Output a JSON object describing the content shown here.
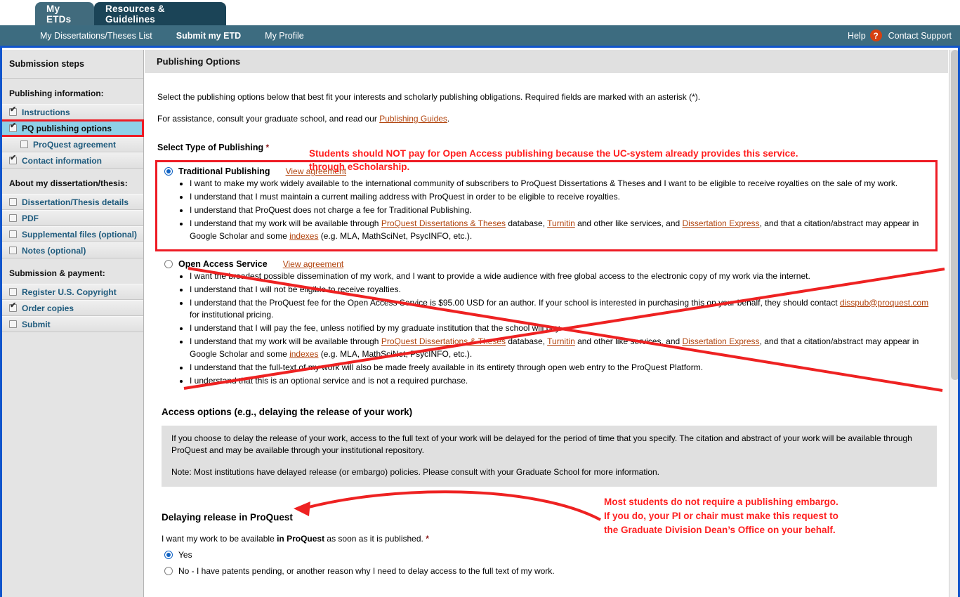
{
  "tabs": [
    {
      "label": "My ETDs",
      "active": true
    },
    {
      "label": "Resources & Guidelines",
      "active": false
    }
  ],
  "nav": {
    "links": [
      {
        "label": "My Dissertations/Theses List",
        "active": false
      },
      {
        "label": "Submit my ETD",
        "active": true
      },
      {
        "label": "My Profile",
        "active": false
      }
    ],
    "help_label": "Help",
    "help_icon": "question-mark-icon",
    "contact_label": "Contact Support"
  },
  "sidebar": {
    "title": "Submission steps",
    "groups": [
      {
        "heading": "Publishing information:",
        "items": [
          {
            "label": "Instructions",
            "checked": true,
            "sub": false,
            "selected": false
          },
          {
            "label": "PQ publishing options",
            "checked": true,
            "sub": false,
            "selected": true
          },
          {
            "label": "ProQuest agreement",
            "checked": false,
            "sub": true,
            "selected": false
          },
          {
            "label": "Contact information",
            "checked": true,
            "sub": false,
            "selected": false
          }
        ]
      },
      {
        "heading": "About my dissertation/thesis:",
        "items": [
          {
            "label": "Dissertation/Thesis details",
            "checked": false,
            "sub": false,
            "selected": false
          },
          {
            "label": "PDF",
            "checked": false,
            "sub": false,
            "selected": false
          },
          {
            "label": "Supplemental files (optional)",
            "checked": false,
            "sub": false,
            "selected": false
          },
          {
            "label": "Notes (optional)",
            "checked": false,
            "sub": false,
            "selected": false
          }
        ]
      },
      {
        "heading": "Submission & payment:",
        "items": [
          {
            "label": "Register U.S. Copyright",
            "checked": false,
            "sub": false,
            "selected": false
          },
          {
            "label": "Order copies",
            "checked": true,
            "sub": false,
            "selected": false
          },
          {
            "label": "Submit",
            "checked": false,
            "sub": false,
            "selected": false
          }
        ]
      }
    ]
  },
  "main": {
    "header": "Publishing Options",
    "intro1": "Select the publishing options below that best fit your interests and scholarly publishing obligations. Required fields are marked with an asterisk (*).",
    "intro2_pre": "For assistance, consult your graduate school, and read our ",
    "intro2_link": "Publishing Guides",
    "intro2_post": ".",
    "select_type_label": "Select Type of Publishing",
    "required_mark": "*",
    "view_agreement": "View agreement",
    "traditional": {
      "title": "Traditional Publishing",
      "selected": true,
      "bullets": [
        "I want to make my work widely available to the international community of subscribers to ProQuest Dissertations & Theses and I want to be eligible to receive royalties on the sale of my work.",
        "I understand that I must maintain a current mailing address with ProQuest in order to be eligible to receive royalties.",
        "I understand that ProQuest does not charge a fee for Traditional Publishing."
      ],
      "last_bullet": {
        "p1": "I understand that my work will be available through ",
        "l1": "ProQuest Dissertations & Theses",
        "p2": " database, ",
        "l2": "Turnitin",
        "p3": " and other like services, and ",
        "l3": "Dissertation Express",
        "p4": ", and that a citation/abstract may appear in Google Scholar and some ",
        "l4": "indexes",
        "p5": " (e.g. MLA, MathSciNet, PsycINFO, etc.)."
      }
    },
    "openaccess": {
      "title": "Open Access Service",
      "selected": false,
      "bullet1": "I want the broadest possible dissemination of my work, and I want to provide a wide audience with free global access to the electronic copy of my work via the internet.",
      "bullet2": "I understand that I will not be eligible to receive royalties.",
      "bullet3": {
        "p1": "I understand that the ProQuest fee for the Open Access Service is $95.00 USD for an author. If your school is interested in purchasing this on your behalf, they should contact ",
        "l1": "disspub@proquest.com",
        "p2": " for institutional pricing."
      },
      "bullet4": "I understand that I will pay the fee, unless notified by my graduate institution that the school will pay.",
      "bullet5": {
        "p1": "I understand that my work will be available through ",
        "l1": "ProQuest Dissertations & Theses",
        "p2": " database, ",
        "l2": "Turnitin",
        "p3": " and other like services, and ",
        "l3": "Dissertation Express",
        "p4": ", and that a citation/abstract may appear in Google Scholar and some ",
        "l4": "indexes",
        "p5": " (e.g. MLA, MathSciNet, PsycINFO, etc.)."
      },
      "bullet6": "I understand that the full-text of my work will also be made freely available in its entirety through open web entry to the ProQuest Platform.",
      "bullet7": "I understand that this is an optional service and is not a required purchase."
    },
    "access_options": {
      "heading": "Access options (e.g., delaying the release of your work)",
      "para1": "If you choose to delay the release of your work, access to the full text of your work will be delayed for the period of time that you specify. The citation and abstract of your work will be available through ProQuest and may be available through your institutional repository.",
      "para2": "Note: Most institutions have delayed release (or embargo) policies. Please consult with your Graduate School for more information."
    },
    "delay": {
      "heading": "Delaying release in ProQuest",
      "question_pre": "I want my work to be available ",
      "question_bold": "in ProQuest",
      "question_post": " as soon as it is published.",
      "required_mark": "*",
      "options": [
        {
          "label": "Yes",
          "selected": true
        },
        {
          "label": "No - I have patents pending, or another reason why I need to delay access to the full text of my work.",
          "selected": false
        }
      ]
    }
  },
  "annotations": {
    "top": "Students should NOT pay for Open Access publishing because the UC-system already provides this service.\nthrough eScholarship.",
    "embargo": "Most students do not require a publishing embargo.\nIf you do, your PI or chair must make this request to\nthe Graduate Division Dean’s Office on your behalf.",
    "color": "#ff1f1f"
  },
  "colors": {
    "nav_bar": "#3d6c80",
    "tab_active": "#416b7d",
    "tab_inactive": "#1b4457",
    "accent_blue": "#1155cc",
    "link": "#b1440e",
    "selected_step": "#8ed0e8",
    "annotation_red": "#ff1f1f"
  }
}
